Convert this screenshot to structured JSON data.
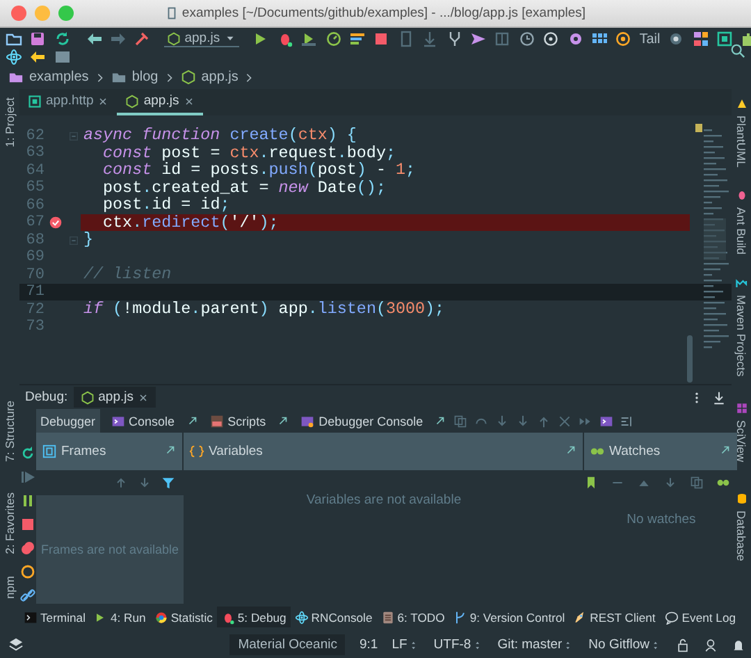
{
  "window": {
    "title": "examples [~/Documents/github/examples] - .../blog/app.js [examples]"
  },
  "toolbar": {
    "run_config": "app.js",
    "tail_label": "Tail"
  },
  "breadcrumbs": [
    {
      "label": "examples"
    },
    {
      "label": "blog"
    },
    {
      "label": "app.js"
    }
  ],
  "left_tool_windows": [
    {
      "label": "1: Project"
    },
    {
      "label": "7: Structure"
    },
    {
      "label": "2: Favorites"
    },
    {
      "label": "npm"
    }
  ],
  "right_tool_windows": [
    {
      "label": "PlantUML"
    },
    {
      "label": "Ant Build"
    },
    {
      "label": "Maven Projects"
    },
    {
      "label": "SciView"
    },
    {
      "label": "Database"
    }
  ],
  "editor_tabs": [
    {
      "label": "app.http",
      "selected": false
    },
    {
      "label": "app.js",
      "selected": true
    }
  ],
  "code_lines": [
    {
      "number": "62",
      "fold": true,
      "breakpoint": false,
      "current": false,
      "tokens": [
        {
          "kind": "kw",
          "text": "async"
        },
        {
          "kind": "kw",
          "text": " function"
        },
        {
          "kind": "fn",
          "text": " create"
        },
        {
          "kind": "punct",
          "text": "("
        },
        {
          "kind": "param",
          "text": "ctx"
        },
        {
          "kind": "punct",
          "text": ") {"
        }
      ]
    },
    {
      "number": "63",
      "fold": false,
      "breakpoint": false,
      "current": false,
      "tokens": [
        {
          "kind": "kw",
          "text": "  const"
        },
        {
          "kind": "plain",
          "text": " post = "
        },
        {
          "kind": "param",
          "text": "ctx"
        },
        {
          "kind": "punct",
          "text": "."
        },
        {
          "kind": "plain",
          "text": "request"
        },
        {
          "kind": "punct",
          "text": "."
        },
        {
          "kind": "plain",
          "text": "body"
        },
        {
          "kind": "punct",
          "text": ";"
        }
      ]
    },
    {
      "number": "64",
      "fold": false,
      "breakpoint": false,
      "current": false,
      "tokens": [
        {
          "kind": "kw",
          "text": "  const"
        },
        {
          "kind": "plain",
          "text": " id = posts"
        },
        {
          "kind": "punct",
          "text": "."
        },
        {
          "kind": "fn",
          "text": "push"
        },
        {
          "kind": "punct",
          "text": "("
        },
        {
          "kind": "plain",
          "text": "post"
        },
        {
          "kind": "punct",
          "text": ")"
        },
        {
          "kind": "plain",
          "text": " - "
        },
        {
          "kind": "number",
          "text": "1"
        },
        {
          "kind": "punct",
          "text": ";"
        }
      ]
    },
    {
      "number": "65",
      "fold": false,
      "breakpoint": false,
      "current": false,
      "tokens": [
        {
          "kind": "plain",
          "text": "  post"
        },
        {
          "kind": "punct",
          "text": "."
        },
        {
          "kind": "plain",
          "text": "created_at = "
        },
        {
          "kind": "kw",
          "text": "new"
        },
        {
          "kind": "plain",
          "text": " Date"
        },
        {
          "kind": "punct",
          "text": "();"
        }
      ]
    },
    {
      "number": "66",
      "fold": false,
      "breakpoint": false,
      "current": false,
      "tokens": [
        {
          "kind": "plain",
          "text": "  post"
        },
        {
          "kind": "punct",
          "text": "."
        },
        {
          "kind": "plain",
          "text": "id = id"
        },
        {
          "kind": "punct",
          "text": ";"
        }
      ]
    },
    {
      "number": "67",
      "fold": false,
      "breakpoint": true,
      "current": false,
      "tokens": [
        {
          "kind": "plain",
          "text": "  ctx"
        },
        {
          "kind": "punct",
          "text": "."
        },
        {
          "kind": "fn",
          "text": "redirect"
        },
        {
          "kind": "punct",
          "text": "("
        },
        {
          "kind": "string",
          "text": "'/'"
        },
        {
          "kind": "punct",
          "text": ");"
        }
      ]
    },
    {
      "number": "68",
      "fold": true,
      "breakpoint": false,
      "current": false,
      "tokens": [
        {
          "kind": "punct",
          "text": "}"
        }
      ]
    },
    {
      "number": "69",
      "fold": false,
      "breakpoint": false,
      "current": false
    },
    {
      "number": "70",
      "fold": false,
      "breakpoint": false,
      "current": false,
      "tokens": [
        {
          "kind": "comment",
          "text": "// listen"
        }
      ]
    },
    {
      "number": "71",
      "fold": false,
      "breakpoint": false,
      "current": true
    },
    {
      "number": "72",
      "fold": false,
      "breakpoint": false,
      "current": false,
      "tokens": [
        {
          "kind": "kw",
          "text": "if"
        },
        {
          "kind": "punct",
          "text": " ("
        },
        {
          "kind": "plain",
          "text": "!module"
        },
        {
          "kind": "punct",
          "text": "."
        },
        {
          "kind": "plain",
          "text": "parent"
        },
        {
          "kind": "punct",
          "text": ")"
        },
        {
          "kind": "plain",
          "text": " app"
        },
        {
          "kind": "punct",
          "text": "."
        },
        {
          "kind": "fn",
          "text": "listen"
        },
        {
          "kind": "punct",
          "text": "("
        },
        {
          "kind": "number",
          "text": "3000"
        },
        {
          "kind": "punct",
          "text": ");"
        }
      ]
    },
    {
      "number": "73",
      "fold": false,
      "breakpoint": false,
      "current": false
    }
  ],
  "debug": {
    "label": "Debug:",
    "session_tab": "app.js",
    "tabs": [
      {
        "label": "Debugger",
        "selected": true
      },
      {
        "label": "Console",
        "selected": false
      },
      {
        "label": "Scripts",
        "selected": false
      },
      {
        "label": "Debugger Console",
        "selected": false
      }
    ],
    "panes": [
      {
        "title": "Frames",
        "empty": "Frames are not available"
      },
      {
        "title": "Variables",
        "empty": "Variables are not available"
      },
      {
        "title": "Watches",
        "empty": "No watches"
      }
    ]
  },
  "tool_tabs": [
    {
      "label": "Terminal",
      "selected": false
    },
    {
      "label": "4: Run",
      "selected": false
    },
    {
      "label": "Statistic",
      "selected": false
    },
    {
      "label": "5: Debug",
      "selected": true
    },
    {
      "label": "RNConsole",
      "selected": false
    },
    {
      "label": "6: TODO",
      "selected": false
    },
    {
      "label": "9: Version Control",
      "selected": false
    },
    {
      "label": "REST Client",
      "selected": false
    },
    {
      "label": "Event Log",
      "selected": false
    }
  ],
  "status_bar": {
    "theme": "Material Oceanic",
    "items": [
      {
        "label": "9:1",
        "dropdown": false
      },
      {
        "label": "LF",
        "dropdown": true
      },
      {
        "label": "UTF-8",
        "dropdown": true
      },
      {
        "label": "Git: master",
        "dropdown": true
      },
      {
        "label": "No Gitflow",
        "dropdown": true
      }
    ]
  }
}
